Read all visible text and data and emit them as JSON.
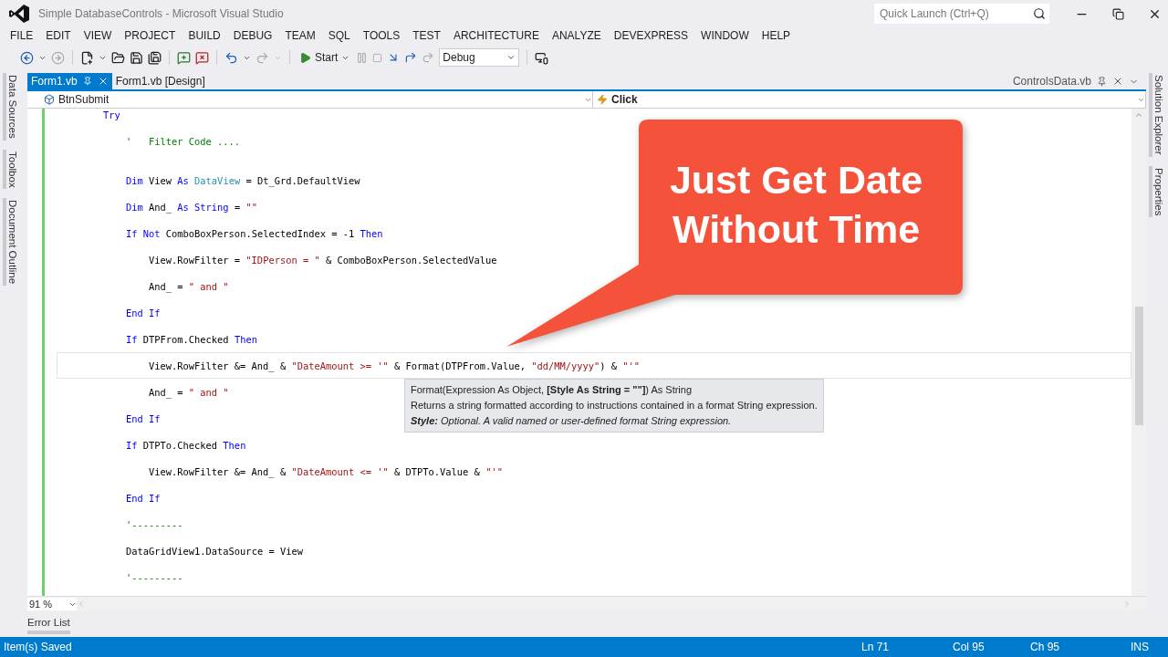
{
  "window": {
    "title": "Simple DatabaseControls - Microsoft Visual Studio",
    "quick_launch": {
      "placeholder": "Quick Launch (Ctrl+Q)"
    }
  },
  "menu": [
    "FILE",
    "EDIT",
    "VIEW",
    "PROJECT",
    "BUILD",
    "DEBUG",
    "TEAM",
    "SQL",
    "TOOLS",
    "TEST",
    "ARCHITECTURE",
    "ANALYZE",
    "DEVEXPRESS",
    "WINDOW",
    "HELP"
  ],
  "toolbar": {
    "start": "Start",
    "configuration": "Debug"
  },
  "side_tabs_left": [
    "Data Sources",
    "Toolbox",
    "Document Outline"
  ],
  "side_tabs_right": [
    "Solution Explorer",
    "Properties"
  ],
  "doc_tabs": [
    {
      "label": "Form1.vb",
      "selected": true
    },
    {
      "label": "Form1.vb [Design]",
      "selected": false
    }
  ],
  "preview_tab": "ControlsData.vb",
  "navigation": {
    "object": "BtnSubmit",
    "event": "Click"
  },
  "code": [
    {
      "tokens": [
        {
          "kind": "keyword",
          "text": "Try"
        }
      ],
      "current": false,
      "children": [
        {
          "tokens": [
            {
              "kind": "comment",
              "text": "'   Filter Code ...."
            }
          ],
          "current": false
        },
        {
          "tokens": [
            {
              "kind": "keyword",
              "text": "Dim"
            },
            {
              "kind": "text",
              "text": " View "
            },
            {
              "kind": "keyword",
              "text": "As"
            },
            {
              "kind": "type",
              "text": " DataView"
            },
            {
              "kind": "text",
              "text": " = Dt_Grd.DefaultView"
            }
          ],
          "current": false
        },
        {
          "tokens": [
            {
              "kind": "keyword",
              "text": "Dim"
            },
            {
              "kind": "text",
              "text": " And_ "
            },
            {
              "kind": "keyword",
              "text": "As String"
            },
            {
              "kind": "text",
              "text": " = "
            },
            {
              "kind": "string",
              "text": "\"\""
            }
          ],
          "current": false
        },
        {
          "tokens": [
            {
              "kind": "keyword",
              "text": "If Not"
            },
            {
              "kind": "text",
              "text": " ComboBoxPerson.SelectedIndex = -1 "
            },
            {
              "kind": "keyword",
              "text": "Then"
            }
          ],
          "current": false,
          "children": [
            {
              "tokens": [
                {
                  "kind": "text",
                  "text": "View.RowFilter = "
                },
                {
                  "kind": "string",
                  "text": "\"IDPerson = \""
                },
                {
                  "kind": "text",
                  "text": " & ComboBoxPerson.SelectedValue"
                }
              ],
              "current": false
            },
            {
              "tokens": [
                {
                  "kind": "text",
                  "text": "And_ = "
                },
                {
                  "kind": "string",
                  "text": "\" and \""
                }
              ],
              "current": false
            }
          ]
        },
        {
          "tokens": [
            {
              "kind": "keyword",
              "text": "End If"
            }
          ],
          "current": false
        },
        {
          "tokens": [
            {
              "kind": "keyword",
              "text": "If"
            },
            {
              "kind": "text",
              "text": " DTPFrom.Checked "
            },
            {
              "kind": "keyword",
              "text": "Then"
            }
          ],
          "current": false,
          "children": [
            {
              "tokens": [
                {
                  "kind": "text",
                  "text": "View.RowFilter &= And_ & "
                },
                {
                  "kind": "string",
                  "text": "\"DateAmount >= '\""
                },
                {
                  "kind": "text",
                  "text": " & Format(DTPFrom.Value, "
                },
                {
                  "kind": "string",
                  "text": "\"dd/MM/yyyy\""
                },
                {
                  "kind": "text",
                  "text": ") & "
                },
                {
                  "kind": "string",
                  "text": "\"'\""
                }
              ],
              "current": true
            },
            {
              "tokens": [
                {
                  "kind": "text",
                  "text": "And_ = "
                },
                {
                  "kind": "string",
                  "text": "\" and \""
                }
              ],
              "current": false
            }
          ]
        },
        {
          "tokens": [
            {
              "kind": "keyword",
              "text": "End If"
            }
          ],
          "current": false
        },
        {
          "tokens": [
            {
              "kind": "keyword",
              "text": "If"
            },
            {
              "kind": "text",
              "text": " DTPTo.Checked "
            },
            {
              "kind": "keyword",
              "text": "Then"
            }
          ],
          "current": false,
          "children": [
            {
              "tokens": [
                {
                  "kind": "text",
                  "text": "View.RowFilter &= And_ & "
                },
                {
                  "kind": "string",
                  "text": "\"DateAmount <= '\""
                },
                {
                  "kind": "text",
                  "text": " & DTPTo.Value & "
                },
                {
                  "kind": "string",
                  "text": "\"'\""
                }
              ],
              "current": false
            }
          ]
        },
        {
          "tokens": [
            {
              "kind": "keyword",
              "text": "End If"
            }
          ],
          "current": false
        },
        {
          "tokens": [
            {
              "kind": "comment",
              "text": "'---------"
            }
          ],
          "current": false
        },
        {
          "tokens": [
            {
              "kind": "text",
              "text": "DataGridView1.DataSource = View"
            }
          ],
          "current": false
        },
        {
          "tokens": [
            {
              "kind": "comment",
              "text": "'---------"
            }
          ],
          "current": false
        }
      ]
    }
  ],
  "tooltip": {
    "signature": "Format(Expression As Object, **[Style As String = \"\"]**) As String",
    "description": "Returns a string formatted according to instructions contained in a format String expression.",
    "parameter": "**Style:** Optional. A valid named or user-defined format String expression."
  },
  "callout": "Just Get Date Without Time",
  "zoom": "91 %",
  "bottom_tab": "Error List",
  "status": {
    "message": "Item(s) Saved",
    "line": "Ln 71",
    "column": "Col 95",
    "char": "Ch 95",
    "mode": "INS"
  }
}
